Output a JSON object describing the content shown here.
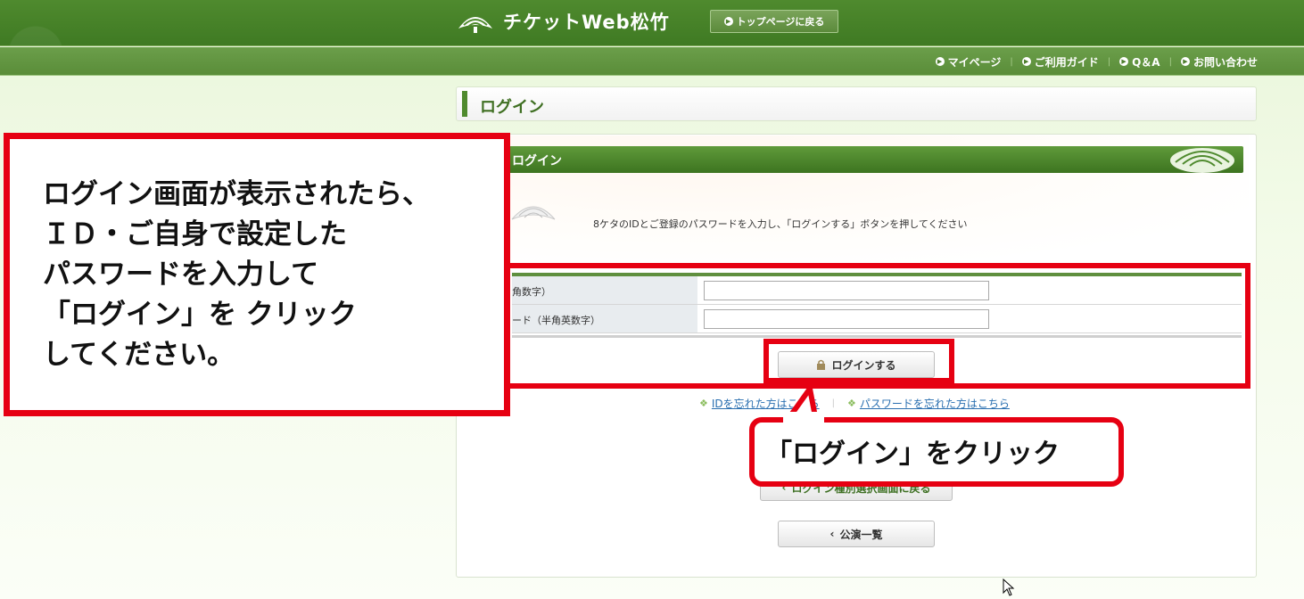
{
  "header": {
    "logo_text": "チケットWeb松竹",
    "top_page_button": "トップページに戻る"
  },
  "subnav": {
    "items": [
      {
        "label": "マイページ"
      },
      {
        "label": "ご利用ガイド"
      },
      {
        "label": "Q＆A"
      },
      {
        "label": "お問い合わせ"
      }
    ]
  },
  "page": {
    "title": "ログイン",
    "section_title": "ログイン",
    "instruction": "8ケタのIDとご登録のパスワードを入力し、「ログインする」ボタンを押してください"
  },
  "form": {
    "id_label": "角数字）",
    "password_label": "ード（半角英数字）",
    "id_value": "",
    "password_value": "",
    "login_button": "ログインする"
  },
  "links": {
    "forgot_id": "IDを忘れた方はこちら",
    "forgot_password": "パスワードを忘れた方はこちら"
  },
  "buttons": {
    "back_to_login_type": "ログイン種別選択画面に戻る",
    "performance_list": "公演一覧"
  },
  "annotations": {
    "left_callout": "ログイン画面が表示されたら、\nＩＤ・ご自身で設定した\nパスワードを入力して\n「ログイン」を クリック\nしてください。",
    "bubble": "「ログイン」をクリック"
  },
  "colors": {
    "header_green": "#4f8a2e",
    "annotation_red": "#e60012",
    "link_blue": "#2a6fb0"
  }
}
